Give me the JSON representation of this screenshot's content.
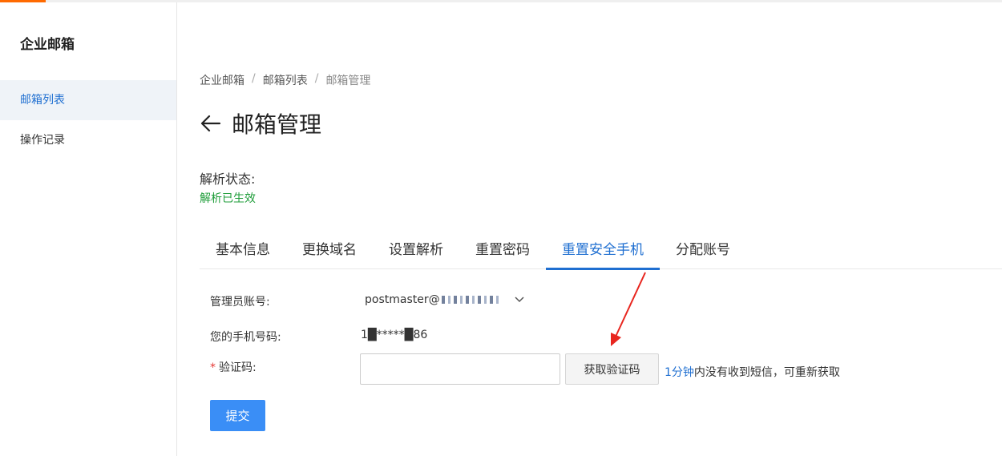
{
  "sidebar": {
    "title": "企业邮箱",
    "items": [
      {
        "label": "邮箱列表"
      },
      {
        "label": "操作记录"
      }
    ]
  },
  "breadcrumb": {
    "items": [
      "企业邮箱",
      "邮箱列表",
      "邮箱管理"
    ],
    "separator": "/"
  },
  "page": {
    "title": "邮箱管理",
    "back_icon": "arrow-left-icon"
  },
  "resolution": {
    "label": "解析状态:",
    "value": "解析已生效"
  },
  "tabs": [
    {
      "label": "基本信息"
    },
    {
      "label": "更换域名"
    },
    {
      "label": "设置解析"
    },
    {
      "label": "重置密码"
    },
    {
      "label": "重置安全手机"
    },
    {
      "label": "分配账号"
    }
  ],
  "form": {
    "account_label": "管理员账号:",
    "account_value": "postmaster@",
    "phone_label": "您的手机号码:",
    "phone_value": "1█*****█86",
    "code_label": "验证码:",
    "required_mark": "*",
    "code_value": "",
    "code_placeholder": "",
    "get_code_button": "获取验证码",
    "resend_hint_accent": "1分钟",
    "resend_hint_rest": "内没有收到短信，可重新获取",
    "submit_button": "提交"
  },
  "colors": {
    "brand_orange": "#ff6a00",
    "primary_blue": "#1f6fd1",
    "submit_blue": "#3a8ef6",
    "success_green": "#1f9d3a",
    "annotation_red": "#e8261f"
  }
}
